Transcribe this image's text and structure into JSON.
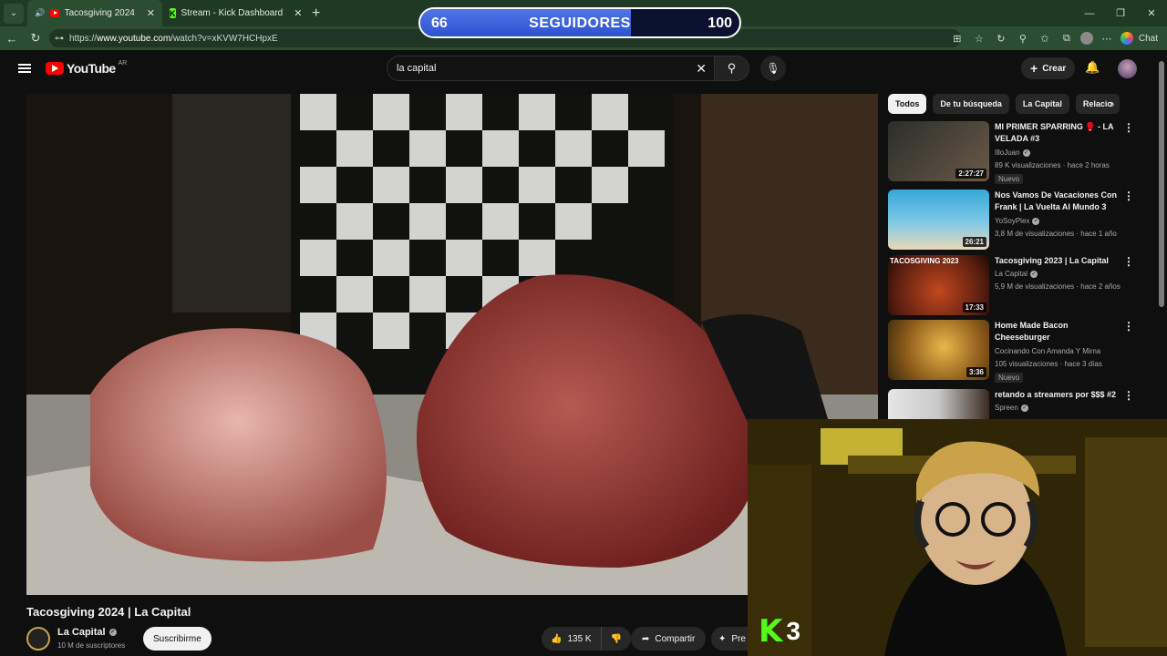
{
  "browser": {
    "tabs": [
      {
        "label": "Tacosgiving 2024 | La Capital",
        "favicon": "youtube-icon",
        "active": true
      },
      {
        "label": "Stream - Kick Dashboard",
        "favicon": "kick-icon",
        "active": false
      }
    ],
    "url_prefix": "https://",
    "url_host": "www.youtube.com",
    "url_path": "/watch?v=xKVW7HCHpxE",
    "chat_label": "Chat"
  },
  "followers": {
    "current": "66",
    "label": "SEGUIDORES",
    "goal": "100",
    "progress_fraction": 0.66
  },
  "youtube": {
    "logo_text": "YouTube",
    "country": "AR",
    "search_value": "la capital",
    "create_label": "Crear"
  },
  "video": {
    "title": "Tacosgiving 2024 | La Capital",
    "channel": "La Capital",
    "subscribers": "10 M de suscriptores",
    "subscribe_label": "Suscribirme",
    "likes": "135 K",
    "share_label": "Compartir",
    "more_label": "Pre"
  },
  "chips": [
    "Todos",
    "De tu búsqueda",
    "La Capital",
    "Relacio"
  ],
  "recommendations": [
    {
      "title": "MI PRIMER SPARRING 🥊 - LA VELADA #3",
      "channel": "IlloJuan",
      "meta": "89 K visualizaciones · hace 2 horas",
      "duration": "2:27:27",
      "badge": "Nuevo",
      "thumb_text": "",
      "colors": [
        "#2a2e2a",
        "#6b5a48"
      ]
    },
    {
      "title": "Nos Vamos De Vacaciones Con Frank | La Vuelta Al Mundo 3",
      "channel": "YoSoyPlex",
      "meta": "3,8 M de visualizaciones · hace 1 año",
      "duration": "26:21",
      "badge": "",
      "thumb_text": "",
      "colors": [
        "#35a8d8",
        "#e9d9b8"
      ]
    },
    {
      "title": "Tacosgiving 2023 | La Capital",
      "channel": "La Capital",
      "meta": "5,9 M de visualizaciones · hace 2 años",
      "duration": "17:33",
      "badge": "",
      "thumb_text": "TACOSGIVING 2023",
      "colors": [
        "#5a1e10",
        "#c2471e"
      ]
    },
    {
      "title": "Home Made Bacon Cheeseburger",
      "channel": "Cocinando Con Amanda Y Mirna",
      "meta": "105 visualizaciones · hace 3 días",
      "duration": "3:36",
      "badge": "Nuevo",
      "thumb_text": "",
      "colors": [
        "#8b5a1a",
        "#e8b84a"
      ]
    },
    {
      "title": "retando a streamers por $$$ #2",
      "channel": "Spreen",
      "meta": "",
      "duration": "",
      "badge": "",
      "thumb_text": "",
      "colors": [
        "#e6e6e6",
        "#3a2a22"
      ]
    }
  ],
  "overlay": {
    "kick_letter": "K",
    "kick_count": "3"
  }
}
